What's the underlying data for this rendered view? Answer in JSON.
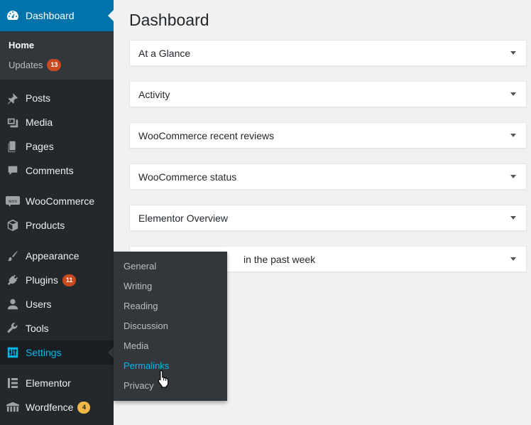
{
  "sidebar": {
    "dashboard_label": "Dashboard",
    "dashboard_sub": [
      {
        "label": "Home",
        "current": true
      },
      {
        "label": "Updates",
        "badge": "13"
      }
    ],
    "items": {
      "posts": "Posts",
      "media": "Media",
      "pages": "Pages",
      "comments": "Comments",
      "woocommerce": "WooCommerce",
      "products": "Products",
      "appearance": "Appearance",
      "plugins": "Plugins",
      "plugins_badge": "11",
      "users": "Users",
      "tools": "Tools",
      "settings": "Settings",
      "elementor": "Elementor",
      "wordfence": "Wordfence",
      "wordfence_badge": "4"
    }
  },
  "flyout": {
    "items": [
      "General",
      "Writing",
      "Reading",
      "Discussion",
      "Media",
      "Permalinks",
      "Privacy"
    ],
    "hovered": "Permalinks"
  },
  "main": {
    "title": "Dashboard",
    "widgets": [
      "At a Glance",
      "Activity",
      "WooCommerce recent reviews",
      "WooCommerce status",
      "Elementor Overview",
      "in the past week"
    ]
  },
  "colors": {
    "sidebar_bg": "#23282d",
    "active_blue": "#0073aa",
    "link_hover": "#00b9eb",
    "badge_red": "#ca4a1f",
    "badge_yellow": "#f0b849"
  }
}
